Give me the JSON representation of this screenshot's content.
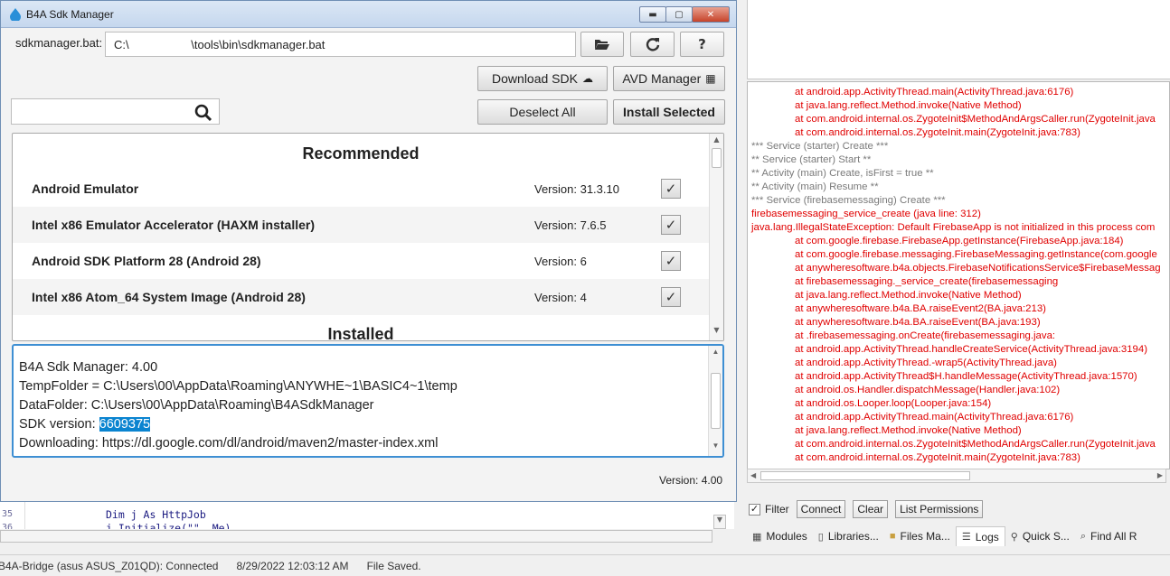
{
  "dialog": {
    "title": "B4A Sdk Manager",
    "path_label": "sdkmanager.bat:",
    "path_value": "C:\\                   \\tools\\bin\\sdkmanager.bat",
    "buttons": {
      "download_sdk": "Download SDK",
      "avd_manager": "AVD Manager",
      "deselect_all": "Deselect All",
      "install_selected": "Install Selected",
      "help": "?"
    },
    "search": {
      "value": ""
    },
    "sections": {
      "recommended": "Recommended",
      "installed": "Installed"
    },
    "packages": [
      {
        "name": "Android Emulator",
        "version": "Version: 31.3.10",
        "checked": true
      },
      {
        "name": "Intel x86 Emulator Accelerator (HAXM installer)",
        "version": "Version: 7.6.5",
        "checked": true
      },
      {
        "name": "Android SDK Platform 28 (Android 28)",
        "version": "Version: 6",
        "checked": true
      },
      {
        "name": "Intel x86 Atom_64 System Image (Android 28)",
        "version": "Version: 4",
        "checked": true
      }
    ],
    "console": {
      "line1": "B4A Sdk Manager: 4.00",
      "line2": "TempFolder = C:\\Users\\00\\AppData\\Roaming\\ANYWHE~1\\BASIC4~1\\temp",
      "line3": "DataFolder: C:\\Users\\00\\AppData\\Roaming\\B4ASdkManager",
      "line4_prefix": "SDK version: ",
      "line4_selected": "6609375",
      "line5": "Downloading: https://dl.google.com/dl/android/maven2/master-index.xml"
    },
    "version_footer": "Version: 4.00"
  },
  "logs": [
    {
      "text": "at android.app.ActivityThread.main(ActivityThread.java:6176)",
      "color": "red",
      "indent": true
    },
    {
      "text": "at java.lang.reflect.Method.invoke(Native Method)",
      "color": "red",
      "indent": true
    },
    {
      "text": "at com.android.internal.os.ZygoteInit$MethodAndArgsCaller.run(ZygoteInit.java",
      "color": "red",
      "indent": true
    },
    {
      "text": "at com.android.internal.os.ZygoteInit.main(ZygoteInit.java:783)",
      "color": "red",
      "indent": true
    },
    {
      "text": "*** Service (starter) Create ***",
      "color": "gray",
      "indent": false
    },
    {
      "text": "** Service (starter) Start **",
      "color": "gray",
      "indent": false
    },
    {
      "text": "** Activity (main) Create, isFirst = true **",
      "color": "gray",
      "indent": false
    },
    {
      "text": "** Activity (main) Resume **",
      "color": "gray",
      "indent": false
    },
    {
      "text": "*** Service (firebasemessaging) Create ***",
      "color": "gray",
      "indent": false
    },
    {
      "text": "firebasemessaging_service_create (java line: 312)",
      "color": "red",
      "indent": false
    },
    {
      "text": "java.lang.IllegalStateException: Default FirebaseApp is not initialized in this process com",
      "color": "red",
      "indent": false
    },
    {
      "text": "at com.google.firebase.FirebaseApp.getInstance(FirebaseApp.java:184)",
      "color": "red",
      "indent": true
    },
    {
      "text": "at com.google.firebase.messaging.FirebaseMessaging.getInstance(com.google",
      "color": "red",
      "indent": true
    },
    {
      "text": "at anywheresoftware.b4a.objects.FirebaseNotificationsService$FirebaseMessag",
      "color": "red",
      "indent": true
    },
    {
      "text": "at                              firebasemessaging._service_create(firebasemessaging",
      "color": "red",
      "indent": true
    },
    {
      "text": "at java.lang.reflect.Method.invoke(Native Method)",
      "color": "red",
      "indent": true
    },
    {
      "text": "at anywheresoftware.b4a.BA.raiseEvent2(BA.java:213)",
      "color": "red",
      "indent": true
    },
    {
      "text": "at anywheresoftware.b4a.BA.raiseEvent(BA.java:193)",
      "color": "red",
      "indent": true
    },
    {
      "text": "at                              .firebasemessaging.onCreate(firebasemessaging.java:",
      "color": "red",
      "indent": true
    },
    {
      "text": "at android.app.ActivityThread.handleCreateService(ActivityThread.java:3194)",
      "color": "red",
      "indent": true
    },
    {
      "text": "at android.app.ActivityThread.-wrap5(ActivityThread.java)",
      "color": "red",
      "indent": true
    },
    {
      "text": "at android.app.ActivityThread$H.handleMessage(ActivityThread.java:1570)",
      "color": "red",
      "indent": true
    },
    {
      "text": "at android.os.Handler.dispatchMessage(Handler.java:102)",
      "color": "red",
      "indent": true
    },
    {
      "text": "at android.os.Looper.loop(Looper.java:154)",
      "color": "red",
      "indent": true
    },
    {
      "text": "at android.app.ActivityThread.main(ActivityThread.java:6176)",
      "color": "red",
      "indent": true
    },
    {
      "text": "at java.lang.reflect.Method.invoke(Native Method)",
      "color": "red",
      "indent": true
    },
    {
      "text": "at com.android.internal.os.ZygoteInit$MethodAndArgsCaller.run(ZygoteInit.java",
      "color": "red",
      "indent": true
    },
    {
      "text": "at com.android.internal.os.ZygoteInit.main(ZygoteInit.java:783)",
      "color": "red",
      "indent": true
    }
  ],
  "log_controls": {
    "filter_label": "Filter",
    "filter_checked": true,
    "connect": "Connect",
    "clear": "Clear",
    "list_permissions": "List Permissions"
  },
  "bottom_tabs": [
    {
      "label": "Modules",
      "icon": "modules-icon"
    },
    {
      "label": "Libraries...",
      "icon": "libraries-icon"
    },
    {
      "label": "Files Ma...",
      "icon": "folder-icon"
    },
    {
      "label": "Logs",
      "icon": "logs-icon",
      "active": true
    },
    {
      "label": "Quick S...",
      "icon": "search-icon"
    },
    {
      "label": "Find All R",
      "icon": "find-icon"
    }
  ],
  "code": {
    "line_numbers": [
      "35",
      "36"
    ],
    "lines": [
      "Dim j As HttpJob",
      "j.Initialize(\"\", Me)"
    ]
  },
  "status_bar": {
    "connection": "B4A-Bridge (asus ASUS_Z01QD): Connected",
    "timestamp": "8/29/2022 12:03:12 AM",
    "message": "File Saved."
  },
  "colors": {
    "log_error": "#e00000",
    "log_info": "#7a7a7a",
    "selection": "#0a84d0",
    "focus_border": "#3e8fd3"
  }
}
